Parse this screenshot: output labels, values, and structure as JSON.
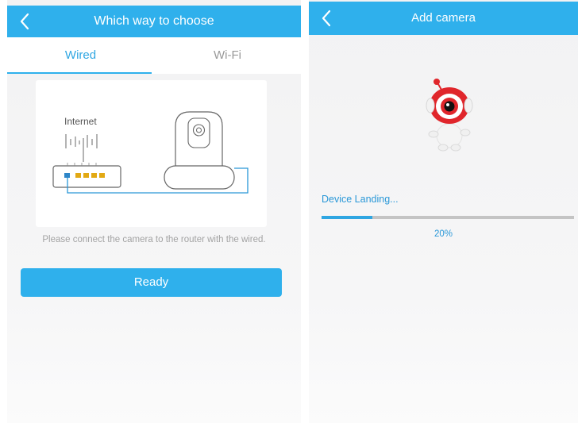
{
  "left_screen": {
    "title": "Which way to choose",
    "tabs": [
      "Wired",
      "Wi-Fi"
    ],
    "active_tab": "Wired",
    "diagram": {
      "label": "Internet"
    },
    "instruction": "Please connect the camera to the router with the wired.",
    "ready_label": "Ready"
  },
  "right_screen": {
    "title": "Add camera",
    "status": "Device Landing...",
    "progress": 0.2,
    "progress_label": "20%"
  },
  "colors": {
    "accent": "#2fb0ec",
    "router_port_blue": "#2e86c8",
    "router_port_yellow": "#e2a914",
    "mascot_red": "#e0262b"
  },
  "icons": [
    "back-arrow-icon",
    "back-arrow-icon",
    "mascot-icon"
  ]
}
